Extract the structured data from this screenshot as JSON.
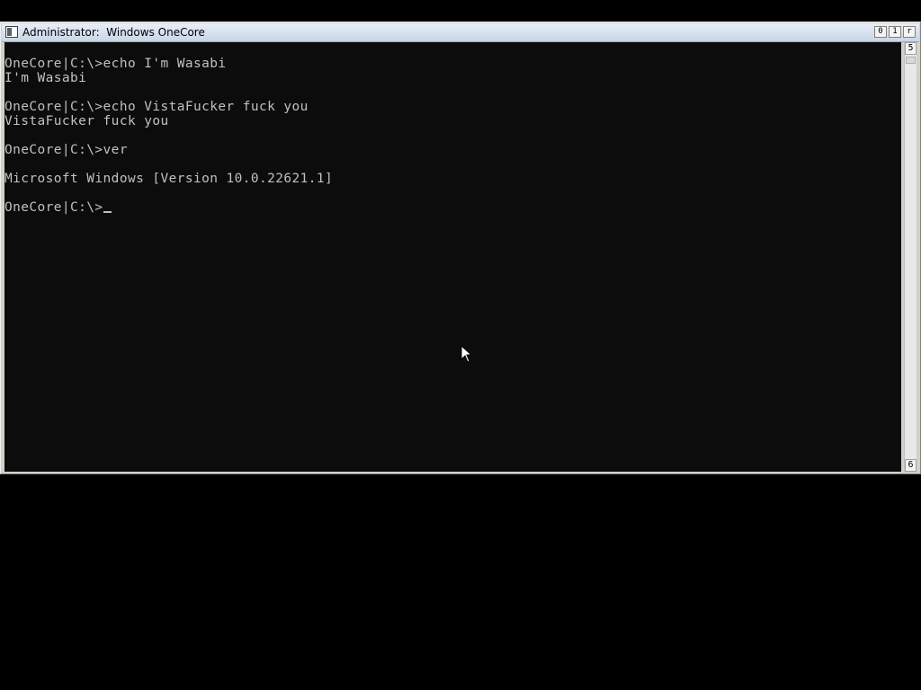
{
  "window": {
    "title": "Administrator:  Windows OneCore",
    "caption_buttons": {
      "minimize": "0",
      "maximize": "1",
      "close": "r"
    }
  },
  "console": {
    "lines": [
      "",
      "OneCore|C:\\>echo I'm Wasabi",
      "I'm Wasabi",
      "",
      "OneCore|C:\\>echo VistaFucker fuck you",
      "VistaFucker fuck you",
      "",
      "OneCore|C:\\>ver",
      "",
      "Microsoft Windows [Version 10.0.22621.1]",
      "",
      "OneCore|C:\\>"
    ],
    "text_color": "#c0c0c0",
    "background_color": "#0c0c0c"
  },
  "scrollbar": {
    "up_glyph": "5",
    "down_glyph": "6"
  }
}
